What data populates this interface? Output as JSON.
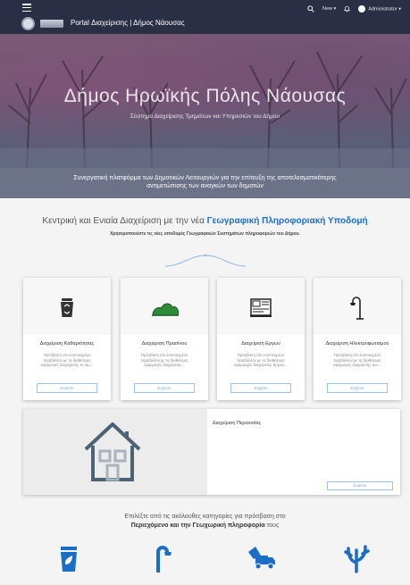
{
  "header": {
    "portal_title": "Portal Διαχείρισης | Δήμος Νάουσας",
    "new_label": "New ▾",
    "user_label": "Administrator ▾"
  },
  "hero": {
    "title": "Δήμος Ηρωϊκής Πόλης Νάουσας",
    "subtitle": "Σύστημα Διαχείρισης Τμημάτων και Υπηρεσιών του Δήμου"
  },
  "banner": {
    "line1": "Συνεργατική πλατφόρμα των Δημοτικών Λειτουργιών για την επίτευξη της αποτελεσματικότερης",
    "line2": "αντιμετώπισης των αναγκών των δημοτών"
  },
  "intro": {
    "title_prefix": "Κεντρική και Ενιαία Διαχείριση με την νέα",
    "title_highlight": "Γεωγραφική Πληροφοριακή Υποδομή",
    "subtitle": "Χρησιμοποιείστε τις νέες υποδομές Γεωγραφικών Συστημάτων πληροφοριών του Δήμου."
  },
  "cards": [
    {
      "title": "Διαχείριση Καθαριότητας",
      "desc": "Πρόσβαση στο ενοποιημένο περιβάλλον με τις διαθέσιμες εφαρμογές διαχείρισης το τομ...",
      "button": "Explore",
      "icon": "recycle-bin-icon"
    },
    {
      "title": "Διαχείριση Πρασίνου",
      "desc": "Πρόσβαση στο ενοποιημένο περιβάλλον με τις διαθέσιμες εφαρμογές διαχείρισης...",
      "button": "Explore",
      "icon": "green-bushes-icon"
    },
    {
      "title": "Διαχείριση Εργων",
      "desc": "Πρόσβαση στο ενοποιημένο περιβάλλον με τις διαθέσιμες εφαρμογές διαχείρισης Εργων...",
      "button": "Explore",
      "icon": "blueprint-icon"
    },
    {
      "title": "Διαχείριση Ηλεκτροφωτισμού",
      "desc": "Πρόσβαση στο ενοποιημένο περιβάλλον με τις διαθέσιμες εφαρμογές διαχείρισης των...",
      "button": "Explore",
      "icon": "street-lamp-icon"
    }
  ],
  "property": {
    "title": "Διαχείριση Περιουσίας",
    "button": "Explore",
    "icon": "house-icon"
  },
  "categories": {
    "line1": "Επιλέξτε από τις ακόλουθες κατηγορίες για πρόσβαση στο",
    "line2_bold": "Περιεχόμενο και την Γεωχωρική πληροφορία",
    "line2_rest": "τους"
  },
  "bottom_icons": [
    "recycle-bin-icon",
    "street-lamp-icon",
    "truck-icon",
    "coral-tree-icon"
  ],
  "colors": {
    "topbar": "#2a2f45",
    "accent_blue": "#1d6fc9",
    "icon_green": "#2e8b3a",
    "icon_blue": "#1a6fc4"
  }
}
